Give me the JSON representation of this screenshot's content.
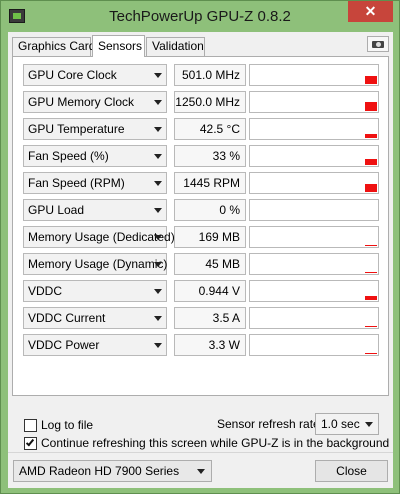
{
  "window": {
    "title": "TechPowerUp GPU-Z 0.8.2",
    "close_glyph": "✕"
  },
  "tabs": [
    {
      "label": "Graphics Card",
      "active": false
    },
    {
      "label": "Sensors",
      "active": true
    },
    {
      "label": "Validation",
      "active": false
    }
  ],
  "sensors": [
    {
      "name": "GPU Core Clock",
      "value": "501.0 MHz",
      "level": 0.42
    },
    {
      "name": "GPU Memory Clock",
      "value": "1250.0 MHz",
      "level": 0.45
    },
    {
      "name": "GPU Temperature",
      "value": "42.5 °C",
      "level": 0.18
    },
    {
      "name": "Fan Speed (%)",
      "value": "33 %",
      "level": 0.3
    },
    {
      "name": "Fan Speed (RPM)",
      "value": "1445 RPM",
      "level": 0.4
    },
    {
      "name": "GPU Load",
      "value": "0 %",
      "level": 0
    },
    {
      "name": "Memory Usage (Dedicated)",
      "value": "169 MB",
      "level": 0.05
    },
    {
      "name": "Memory Usage (Dynamic)",
      "value": "45 MB",
      "level": 0.05
    },
    {
      "name": "VDDC",
      "value": "0.944 V",
      "level": 0.22
    },
    {
      "name": "VDDC Current",
      "value": "3.5 A",
      "level": 0.05
    },
    {
      "name": "VDDC Power",
      "value": "3.3 W",
      "level": 0.05
    }
  ],
  "options": {
    "log_to_file": {
      "label": "Log to file",
      "checked": false
    },
    "continue_refresh": {
      "label": "Continue refreshing this screen while GPU-Z is in the background",
      "checked": true
    },
    "refresh_rate_label": "Sensor refresh rate:",
    "refresh_rate_value": "1.0 sec"
  },
  "footer": {
    "gpu_selected": "AMD Radeon HD 7900 Series",
    "close_label": "Close"
  },
  "colors": {
    "graph_bar": "#ef1111",
    "titlebar": "#8ec07a"
  },
  "icons": {
    "app": "gpu-z-icon",
    "camera": "camera-icon",
    "dropdown": "chevron-down-icon"
  }
}
